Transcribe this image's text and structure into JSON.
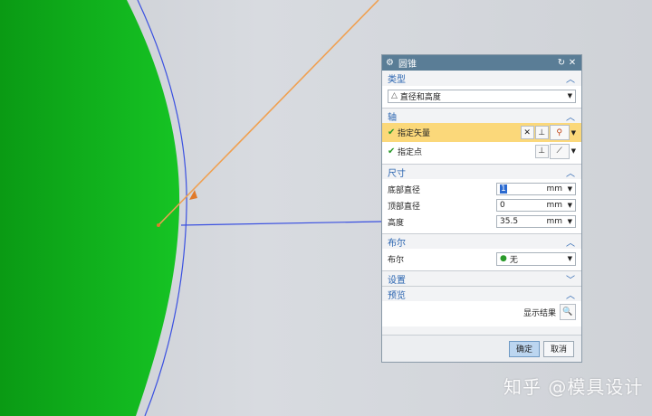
{
  "dialog": {
    "title": "圆锥",
    "sections": {
      "type": {
        "header": "类型",
        "selected": "直径和高度"
      },
      "axis": {
        "header": "轴",
        "vector_label": "指定矢量",
        "point_label": "指定点"
      },
      "dimensions": {
        "header": "尺寸",
        "base_label": "底部直径",
        "base_value": "1",
        "base_unit": "mm",
        "top_label": "顶部直径",
        "top_value": "0",
        "top_unit": "mm",
        "height_label": "高度",
        "height_value": "35.5",
        "height_unit": "mm"
      },
      "boolean": {
        "header": "布尔",
        "label": "布尔",
        "value": "无"
      },
      "settings": {
        "header": "设置"
      },
      "preview": {
        "header": "预览",
        "show_result": "显示结果"
      }
    },
    "buttons": {
      "ok": "确定",
      "cancel": "取消"
    }
  },
  "watermark": "知乎 @模具设计",
  "colors": {
    "title_bar": "#5a7d96",
    "section_header": "#2a64b0",
    "highlight": "#fbd87a",
    "green_body": "#0fae1c",
    "axis_line": "#f0a050"
  }
}
